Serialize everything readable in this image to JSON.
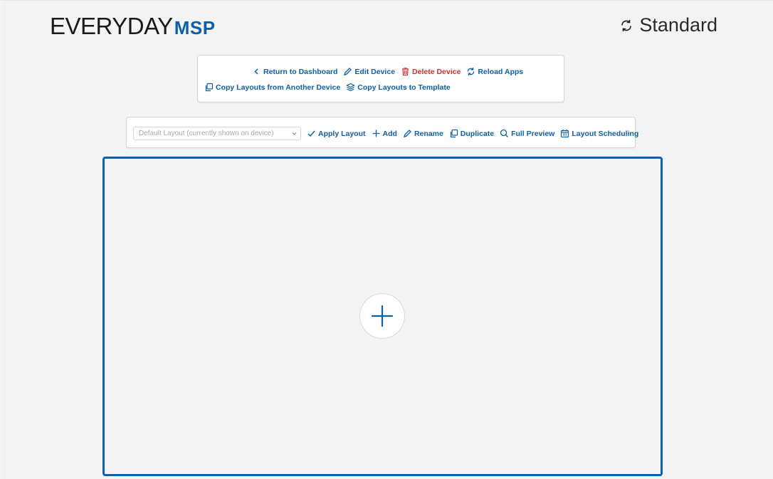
{
  "brand": {
    "part1": "EVERYDAY",
    "part2": "MSP",
    "accent": "#0e5ea8"
  },
  "mode": {
    "label": "Standard",
    "icon": "refresh-icon"
  },
  "device_actions": [
    {
      "label": "Return to Dashboard",
      "icon": "chevron-left-icon"
    },
    {
      "label": "Edit Device",
      "icon": "pencil-icon"
    },
    {
      "label": "Delete Device",
      "icon": "trash-icon",
      "color": "#d12f2f"
    },
    {
      "label": "Reload Apps",
      "icon": "refresh-icon"
    },
    {
      "label": "Copy Layouts from Another Device",
      "icon": "copy-icon"
    },
    {
      "label": "Copy Layouts to Template",
      "icon": "layers-icon"
    }
  ],
  "layout_toolbar": {
    "select_value": "Default Layout (currently shown on device)",
    "actions": [
      {
        "label": "Apply Layout",
        "icon": "check-icon"
      },
      {
        "label": "Add",
        "icon": "plus-icon"
      },
      {
        "label": "Rename",
        "icon": "pencil-icon"
      },
      {
        "label": "Duplicate",
        "icon": "copy-icon"
      },
      {
        "label": "Full Preview",
        "icon": "search-icon"
      },
      {
        "label": "Layout Scheduling",
        "icon": "calendar-icon"
      }
    ]
  },
  "canvas": {
    "add_icon": "plus-icon"
  }
}
